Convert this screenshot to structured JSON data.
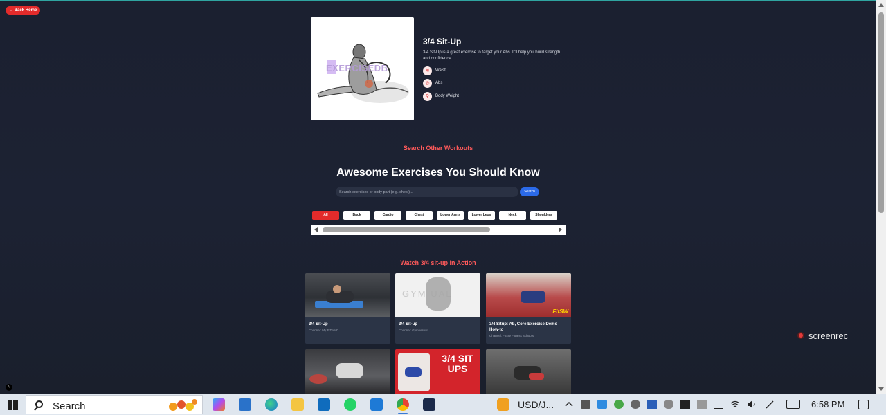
{
  "back_button": {
    "label": "← Back Home"
  },
  "exercise": {
    "image_logo": "EXERCISEDB",
    "title": "3/4 Sit-Up",
    "description": "3/4 Sit-Up is a great exercise to target your Abs. It'll help you build strength and confidence.",
    "tags": [
      {
        "icon": "waist-icon",
        "label": "Waist"
      },
      {
        "icon": "target-icon",
        "label": "Abs"
      },
      {
        "icon": "equipment-icon",
        "label": "Body Weight"
      }
    ]
  },
  "search_section": {
    "kicker": "Search Other Workouts",
    "heading": "Awesome Exercises You Should Know",
    "placeholder": "Search exercises or body part (e.g. chest)...",
    "button": "Search"
  },
  "categories": [
    "All",
    "Back",
    "Cardio",
    "Chest",
    "Lower Arms",
    "Lower Legs",
    "Neck",
    "Shoulders"
  ],
  "active_category": "All",
  "videos_section": {
    "heading": "Watch 3/4 sit-up in Action",
    "videos": [
      {
        "title": "3/4 Sit-Up",
        "channel": "Channel: My FIT Hub"
      },
      {
        "title": "3/4 Sit-up",
        "channel": "Channel: Gym visual"
      },
      {
        "title": "3/4 Situp: Ab, Core Exercise Demo How-to",
        "channel": "Channel: Fit4W Fitness Schools"
      },
      {
        "title": "",
        "channel": ""
      },
      {
        "title": "",
        "channel": "",
        "thumb_text": "3/4 SIT UPS"
      },
      {
        "title": "",
        "channel": ""
      }
    ]
  },
  "overlay": {
    "screenrec": "screenrec",
    "badge": "N"
  },
  "taskbar": {
    "search_label": "Search",
    "ticker": "USD/J...",
    "time": "6:58 PM"
  },
  "colors": {
    "accent": "#e32b2b",
    "link": "#ff5a5a",
    "search_button": "#2b6ae8",
    "background": "#1b2030"
  }
}
